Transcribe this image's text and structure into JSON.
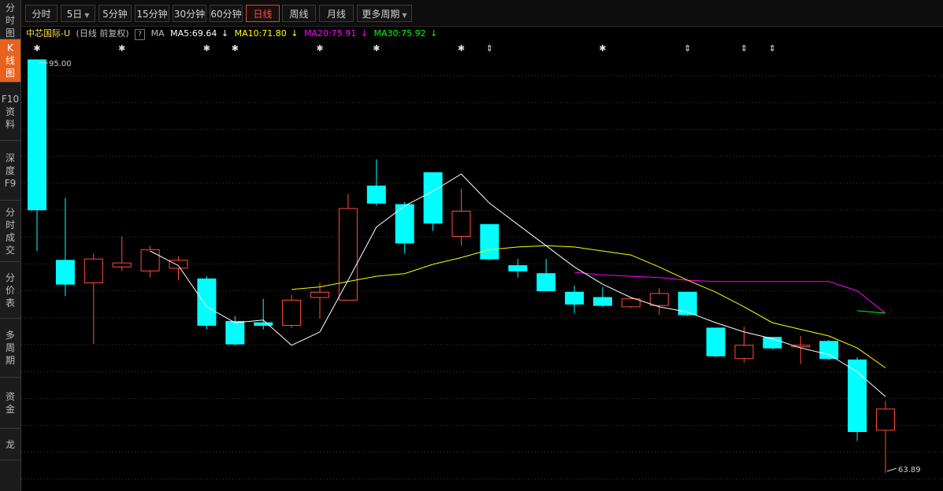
{
  "sidebar": {
    "items": [
      {
        "label": "分\n时\n图",
        "active": false
      },
      {
        "label": "K\n线\n图",
        "active": true
      },
      {
        "label": "F10\n资\n料",
        "active": false
      },
      {
        "label": "深\n度\nF9",
        "active": false
      },
      {
        "label": "分\n时\n成\n交",
        "active": false
      },
      {
        "label": "分\n价\n表",
        "active": false
      },
      {
        "label": "多\n周\n期",
        "active": false
      },
      {
        "label": "资\n金",
        "active": false
      },
      {
        "label": "龙",
        "active": false
      }
    ]
  },
  "toolbar": {
    "periods": [
      {
        "label": "分时",
        "active": false,
        "dropdown": false
      },
      {
        "label": "5日",
        "active": false,
        "dropdown": true
      },
      {
        "label": "5分钟",
        "active": false,
        "dropdown": false
      },
      {
        "label": "15分钟",
        "active": false,
        "dropdown": false
      },
      {
        "label": "30分钟",
        "active": false,
        "dropdown": false
      },
      {
        "label": "60分钟",
        "active": false,
        "dropdown": false
      },
      {
        "label": "日线",
        "active": true,
        "dropdown": false
      },
      {
        "label": "周线",
        "active": false,
        "dropdown": false
      },
      {
        "label": "月线",
        "active": false,
        "dropdown": false
      },
      {
        "label": "更多周期",
        "active": false,
        "dropdown": true
      }
    ]
  },
  "info": {
    "stock_name": "中芯国际-U",
    "period_desc": "(日线 前复权)",
    "help": "?",
    "ma_label": "MA",
    "ma5": "MA5:69.64",
    "ma5_arrow": "↓",
    "ma10": "MA10:71.80",
    "ma10_arrow": "↓",
    "ma20": "MA20:75.91",
    "ma20_arrow": "↓",
    "ma30": "MA30:75.92",
    "ma30_arrow": "↓"
  },
  "colors": {
    "up": "#ff4c3b",
    "down": "#00ffff",
    "ma5": "#ffffff",
    "ma10": "#ffff00",
    "ma20": "#ff00ff",
    "ma30": "#00ff00",
    "grid": "#3a3a3a"
  },
  "chart_data": {
    "type": "candlestick",
    "ylim": [
      63.89,
      95.0
    ],
    "high_label": "95.00",
    "low_label": "63.89",
    "markers": [
      "✱",
      "✱",
      "✱",
      "✱",
      "✱",
      "✱",
      "✱",
      "⇕",
      "✱",
      "⇕",
      "⇕",
      "⇕"
    ],
    "marker_candles": [
      0,
      3,
      6,
      7,
      10,
      12,
      15,
      16,
      20,
      23,
      25,
      26
    ],
    "candles": [
      {
        "o": 95.0,
        "h": 95.0,
        "l": 80.6,
        "c": 83.7
      },
      {
        "o": 79.9,
        "h": 84.6,
        "l": 77.2,
        "c": 78.1
      },
      {
        "o": 78.2,
        "h": 80.4,
        "l": 73.6,
        "c": 80.0
      },
      {
        "o": 79.4,
        "h": 81.7,
        "l": 79.1,
        "c": 79.7
      },
      {
        "o": 79.1,
        "h": 81.0,
        "l": 78.6,
        "c": 80.7
      },
      {
        "o": 79.3,
        "h": 80.2,
        "l": 78.4,
        "c": 79.9
      },
      {
        "o": 78.5,
        "h": 78.7,
        "l": 74.7,
        "c": 75.0
      },
      {
        "o": 75.3,
        "h": 75.7,
        "l": 73.5,
        "c": 73.6
      },
      {
        "o": 75.2,
        "h": 77.0,
        "l": 74.7,
        "c": 75.0
      },
      {
        "o": 75.0,
        "h": 77.3,
        "l": 74.8,
        "c": 76.9
      },
      {
        "o": 77.1,
        "h": 78.2,
        "l": 75.5,
        "c": 77.5
      },
      {
        "o": 76.9,
        "h": 84.9,
        "l": 76.9,
        "c": 83.8
      },
      {
        "o": 85.5,
        "h": 87.5,
        "l": 84.0,
        "c": 84.2
      },
      {
        "o": 84.1,
        "h": 84.3,
        "l": 80.4,
        "c": 81.2
      },
      {
        "o": 86.5,
        "h": 86.5,
        "l": 82.1,
        "c": 82.7
      },
      {
        "o": 81.7,
        "h": 85.3,
        "l": 81.0,
        "c": 83.6
      },
      {
        "o": 82.6,
        "h": 82.6,
        "l": 79.9,
        "c": 80.0
      },
      {
        "o": 79.5,
        "h": 80.0,
        "l": 78.6,
        "c": 79.1
      },
      {
        "o": 78.9,
        "h": 80.0,
        "l": 77.6,
        "c": 77.6
      },
      {
        "o": 77.5,
        "h": 78.0,
        "l": 75.9,
        "c": 76.6
      },
      {
        "o": 77.1,
        "h": 77.9,
        "l": 76.4,
        "c": 76.5
      },
      {
        "o": 76.4,
        "h": 77.1,
        "l": 76.3,
        "c": 77.0
      },
      {
        "o": 76.5,
        "h": 77.8,
        "l": 75.8,
        "c": 77.4
      },
      {
        "o": 77.5,
        "h": 77.5,
        "l": 75.7,
        "c": 75.8
      },
      {
        "o": 74.8,
        "h": 74.8,
        "l": 72.6,
        "c": 72.7
      },
      {
        "o": 72.5,
        "h": 74.9,
        "l": 72.2,
        "c": 73.5
      },
      {
        "o": 74.1,
        "h": 74.1,
        "l": 73.2,
        "c": 73.3
      },
      {
        "o": 73.4,
        "h": 74.2,
        "l": 72.1,
        "c": 73.5
      },
      {
        "o": 73.8,
        "h": 73.9,
        "l": 72.4,
        "c": 72.5
      },
      {
        "o": 72.4,
        "h": 72.6,
        "l": 66.3,
        "c": 67.0
      },
      {
        "o": 67.1,
        "h": 69.3,
        "l": 63.89,
        "c": 68.7
      }
    ],
    "ma5": [
      null,
      null,
      null,
      null,
      80.6,
      79.5,
      76.4,
      75.2,
      75.4,
      73.5,
      74.5,
      78.4,
      82.4,
      84.0,
      85.1,
      86.4,
      84.2,
      82.6,
      81.0,
      79.4,
      78.1,
      77.1,
      76.4,
      76.0,
      75.2,
      74.5,
      74.0,
      73.3,
      72.8,
      71.5,
      69.64
    ],
    "ma10": [
      null,
      null,
      null,
      null,
      null,
      null,
      null,
      null,
      null,
      77.7,
      77.9,
      78.3,
      78.7,
      78.9,
      79.6,
      80.1,
      80.7,
      80.9,
      81.0,
      80.9,
      80.6,
      80.3,
      79.4,
      78.4,
      77.5,
      76.4,
      75.2,
      74.7,
      74.2,
      73.3,
      71.8
    ],
    "ma20": [
      null,
      null,
      null,
      null,
      null,
      null,
      null,
      null,
      null,
      null,
      null,
      null,
      null,
      null,
      null,
      null,
      null,
      null,
      null,
      79.0,
      78.8,
      78.7,
      78.6,
      78.4,
      78.3,
      78.3,
      78.3,
      78.3,
      78.3,
      77.6,
      75.91
    ],
    "ma30": [
      null,
      null,
      null,
      null,
      null,
      null,
      null,
      null,
      null,
      null,
      null,
      null,
      null,
      null,
      null,
      null,
      null,
      null,
      null,
      null,
      null,
      null,
      null,
      null,
      null,
      null,
      null,
      null,
      null,
      76.1,
      75.92
    ]
  }
}
